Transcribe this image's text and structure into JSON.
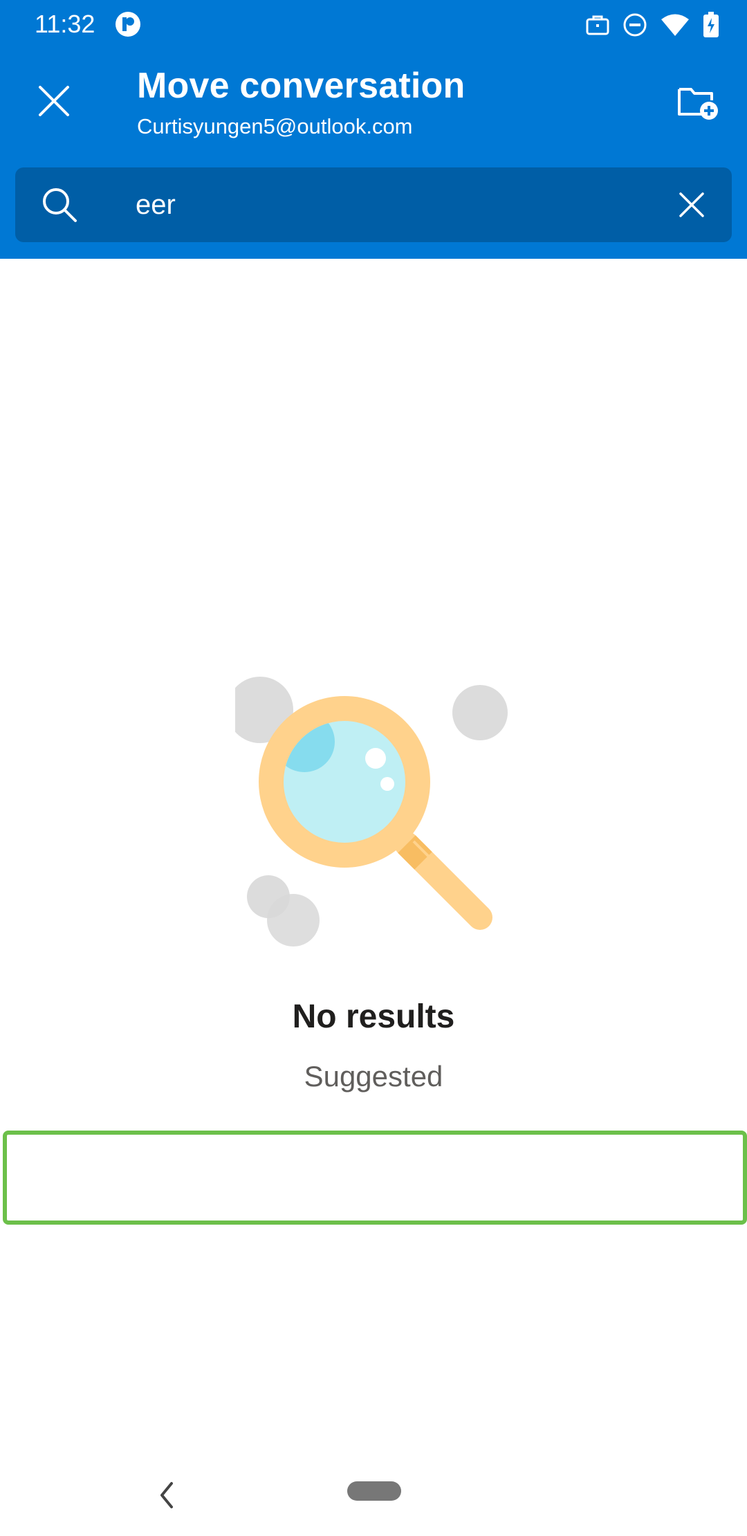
{
  "status_bar": {
    "time": "11:32",
    "icons": [
      "app-badge-icon",
      "briefcase-icon",
      "do-not-disturb-icon",
      "wifi-icon",
      "battery-charging-icon"
    ]
  },
  "header": {
    "title": "Move conversation",
    "account": "Curtisyungen5@outlook.com",
    "close_icon": "close-icon",
    "new_folder_icon": "folder-add-icon"
  },
  "search": {
    "value": "eer",
    "search_icon": "search-icon",
    "clear_icon": "clear-icon"
  },
  "empty_state": {
    "illustration": "magnifier-illustration",
    "message": "No results",
    "section_label": "Suggested"
  },
  "colors": {
    "brand_blue": "#0078d4",
    "search_bg": "#005ea6",
    "highlight_green": "#6cc04a"
  }
}
